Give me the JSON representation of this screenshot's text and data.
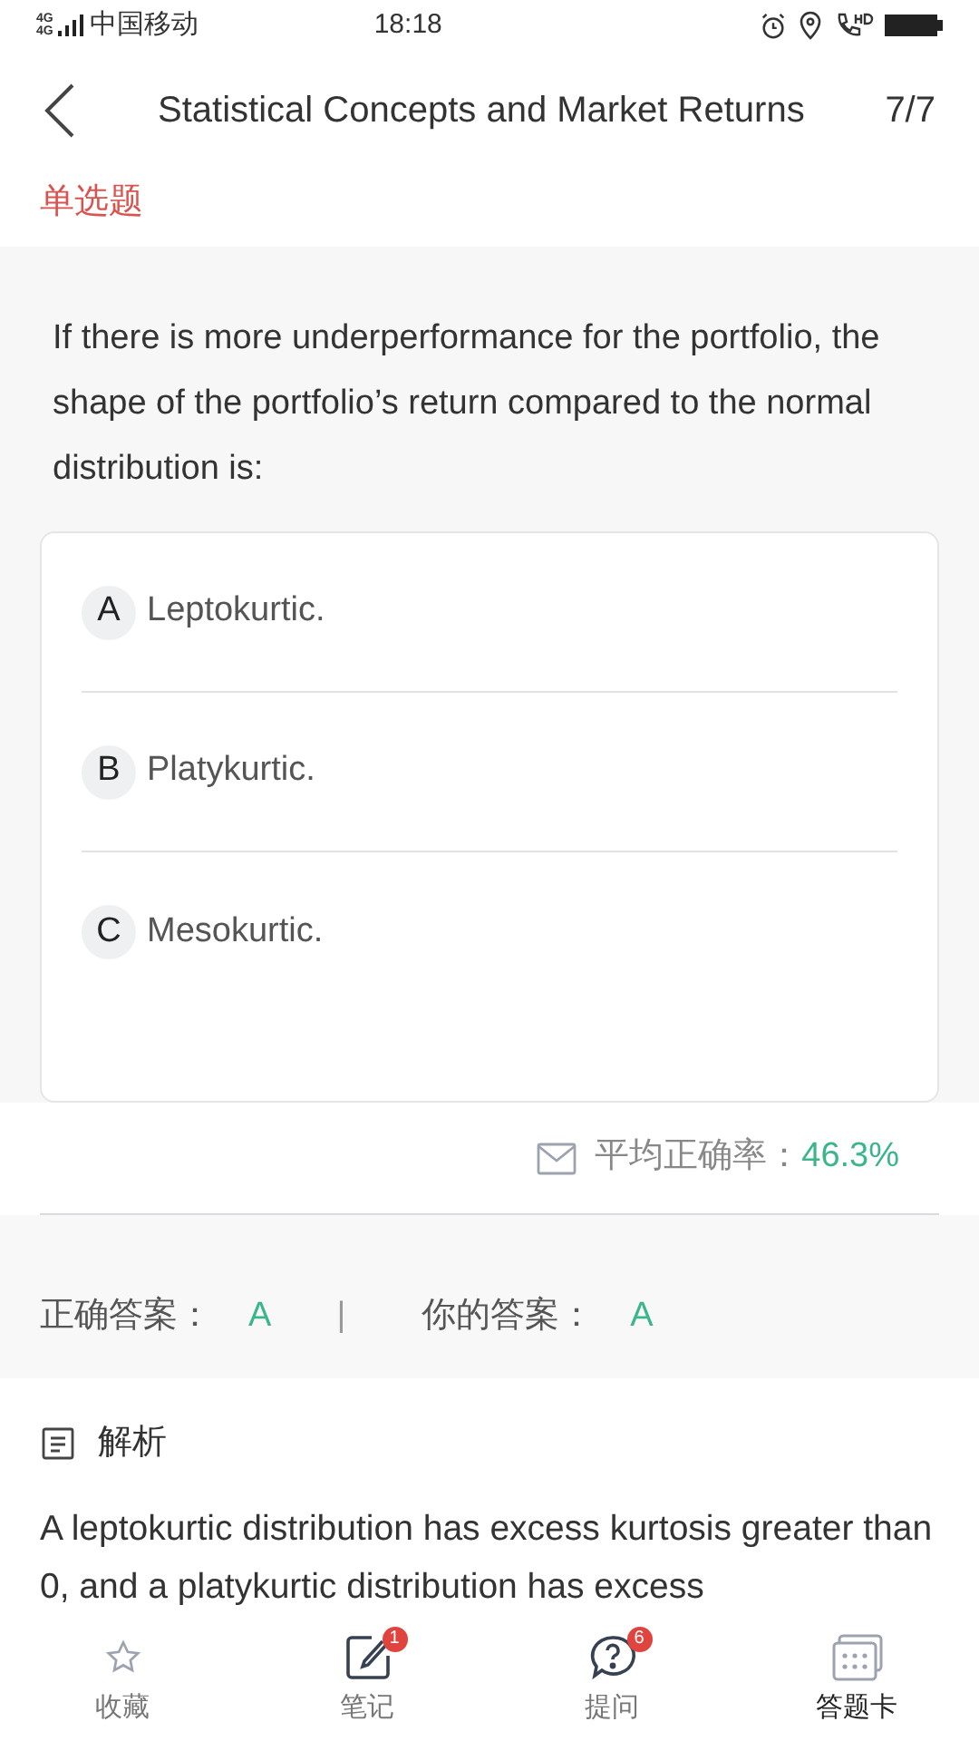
{
  "status_bar": {
    "network": [
      "4G",
      "4G"
    ],
    "carrier": "中国移动",
    "time": "18:18"
  },
  "header": {
    "title": "Statistical Concepts and Market Returns",
    "progress": "7/7"
  },
  "question_type": "单选题",
  "question": "If there is more underperformance for the portfolio, the shape of the portfolio’s return compared to the normal distribution is:",
  "options": [
    {
      "letter": "A",
      "text": "Leptokurtic."
    },
    {
      "letter": "B",
      "text": "Platykurtic."
    },
    {
      "letter": "C",
      "text": "Mesokurtic."
    }
  ],
  "accuracy": {
    "label": "平均正确率：",
    "value": "46.3%"
  },
  "answers": {
    "correct_label": "正确答案：",
    "correct": "A",
    "separator": "|",
    "yours_label": "你的答案：",
    "yours": "A"
  },
  "analysis": {
    "title": "解析",
    "text": "A leptokurtic distribution has excess kurtosis greater than 0, and a platykurtic distribution has excess"
  },
  "bottom_nav": [
    {
      "kind": "star",
      "label": "收藏",
      "selected": false
    },
    {
      "kind": "note",
      "label": "笔记",
      "badge": "1",
      "selected": false
    },
    {
      "kind": "ask",
      "label": "提问",
      "badge": "6",
      "selected": false
    },
    {
      "kind": "card",
      "label": "答题卡",
      "selected": true
    }
  ]
}
